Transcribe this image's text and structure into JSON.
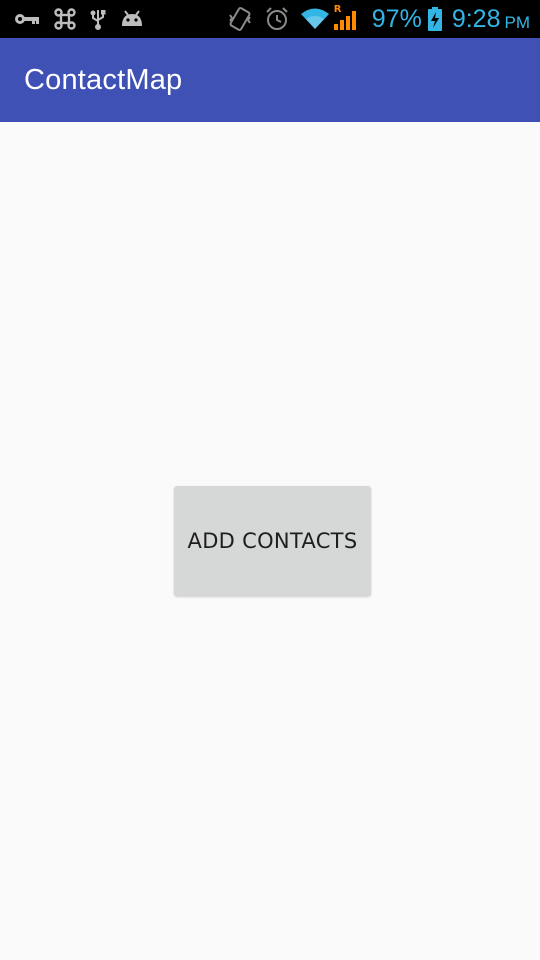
{
  "status_bar": {
    "left_icons": [
      "key-icon",
      "command-icon",
      "usb-icon",
      "android-debug-icon"
    ],
    "right_icons": [
      "vibrate-icon",
      "alarm-icon",
      "wifi-icon",
      "signal-icon",
      "battery-charging-icon"
    ],
    "signal_roaming_label": "R",
    "battery_percent": "97%",
    "time": "9:28",
    "ampm": "PM",
    "text_color": "#33b5e5",
    "background": "#000000"
  },
  "app_bar": {
    "title": "ContactMap",
    "color": "#3f51b5"
  },
  "main": {
    "add_button_label": "ADD CONTACTS"
  }
}
